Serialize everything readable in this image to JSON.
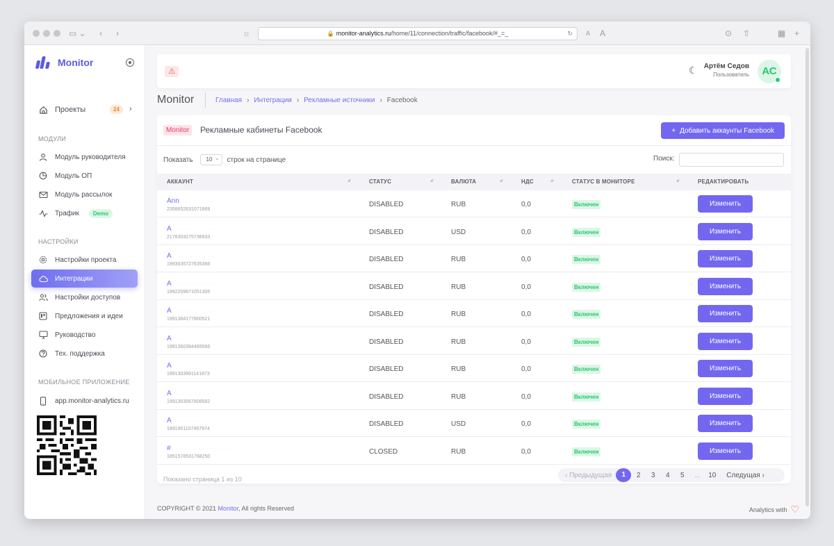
{
  "browser": {
    "url_host": "monitor-analytics.ru",
    "url_path": "/home/11/connection/traffic/facebook/#_=_"
  },
  "sidebar": {
    "brand": "Monitor",
    "projects": {
      "label": "Проекты",
      "count": "24"
    },
    "modules_title": "МОДУЛИ",
    "modules": [
      {
        "label": "Модуль руководителя",
        "icon": "user-icon"
      },
      {
        "label": "Модуль ОП",
        "icon": "pie-chart-icon"
      },
      {
        "label": "Модуль рассылок",
        "icon": "mail-icon"
      },
      {
        "label": "Трафик",
        "icon": "activity-icon",
        "badge": "Demo"
      }
    ],
    "settings_title": "НАСТРОЙКИ",
    "settings": [
      {
        "label": "Настройки проекта",
        "icon": "gear-icon"
      },
      {
        "label": "Интеграции",
        "icon": "cloud-icon",
        "active": true
      },
      {
        "label": "Настройки доступов",
        "icon": "users-icon"
      },
      {
        "label": "Предложения и идеи",
        "icon": "board-icon"
      },
      {
        "label": "Руководство",
        "icon": "monitor-icon"
      },
      {
        "label": "Тех. поддержка",
        "icon": "help-icon"
      }
    ],
    "mobile_title": "МОБИЛЬНОЕ ПРИЛОЖЕНИЕ",
    "mobile_link": "app.monitor-analytics.ru"
  },
  "header": {
    "user_name": "Артём Седов",
    "user_role": "Пользователь",
    "avatar_initials": "АС"
  },
  "page": {
    "title": "Monitor",
    "breadcrumbs": [
      "Главная",
      "Интеграции",
      "Рекламные источники"
    ],
    "breadcrumb_current": "Facebook"
  },
  "card": {
    "tag": "Monitor",
    "title": "Рекламные кабинеты Facebook",
    "add_button": "Добавить аккаунты Facebook",
    "show_label": "Показать",
    "per_page": "10",
    "per_page_suffix": "строк на странице",
    "search_label": "Поиск:",
    "columns": [
      "АККАУНТ",
      "СТАТУС",
      "ВАЛЮТА",
      "НДС",
      "СТАТУС В МОНИТОРЕ",
      "РЕДАКТИРОВАТЬ"
    ],
    "edit_label": "Изменить",
    "rows": [
      {
        "name": "Ann",
        "blur": "· · · · · · ·",
        "id": "2358652631071869",
        "status": "DISABLED",
        "currency": "RUB",
        "vat": "0,0",
        "monitor": "Включен"
      },
      {
        "name": "A",
        "blur": "· · · · · · · · · ·",
        "id": "2178303275736933",
        "status": "DISABLED",
        "currency": "USD",
        "vat": "0,0",
        "monitor": "Включен"
      },
      {
        "name": "A",
        "blur": "· · · · · · · · · ·",
        "id": "1993035727635366",
        "status": "DISABLED",
        "currency": "RUB",
        "vat": "0,0",
        "monitor": "Включен"
      },
      {
        "name": "A",
        "blur": "· · · · · · · · · · ·",
        "id": "1992209671051305",
        "status": "DISABLED",
        "currency": "RUB",
        "vat": "0,0",
        "monitor": "Включен"
      },
      {
        "name": "A",
        "blur": "· · · · · · · · · ·",
        "id": "1991384177800521",
        "status": "DISABLED",
        "currency": "RUB",
        "vat": "0,0",
        "monitor": "Включен"
      },
      {
        "name": "A",
        "blur": "· · · · ·",
        "id": "1991360394469566",
        "status": "DISABLED",
        "currency": "RUB",
        "vat": "0,0",
        "monitor": "Включен"
      },
      {
        "name": "A",
        "blur": "· · · · · ·",
        "id": "1991303991141873",
        "status": "DISABLED",
        "currency": "RUB",
        "vat": "0,0",
        "monitor": "Включен"
      },
      {
        "name": "A",
        "blur": "· · · · · · · · · · · ·",
        "id": "1991303567808582",
        "status": "DISABLED",
        "currency": "RUB",
        "vat": "0,0",
        "monitor": "Включен"
      },
      {
        "name": "A",
        "blur": "· · · · · · · · ·",
        "id": "1891901107497974",
        "status": "DISABLED",
        "currency": "USD",
        "vat": "0,0",
        "monitor": "Включен"
      },
      {
        "name": "#",
        "blur": "· · · · · · · · · · · · · · ·",
        "id": "1851578531768250",
        "status": "CLOSED",
        "currency": "RUB",
        "vat": "0,0",
        "monitor": "Включен"
      }
    ],
    "shown_text": "Показано страница 1 из 10",
    "pager": {
      "prev": "‹ Предыдущая",
      "pages": [
        "1",
        "2",
        "3",
        "4",
        "5"
      ],
      "ellipsis": "...",
      "last": "10",
      "next": "Следущая ›",
      "current": "1"
    }
  },
  "footer": {
    "copyright_prefix": "COPYRIGHT © 2021",
    "brand": "Monitor",
    "copyright_suffix": ", All rights Reserved",
    "right": "Analytics with"
  },
  "colors": {
    "accent": "#7367f0",
    "success": "#28c76f",
    "danger": "#ea5455",
    "warning": "#f08a2f"
  }
}
